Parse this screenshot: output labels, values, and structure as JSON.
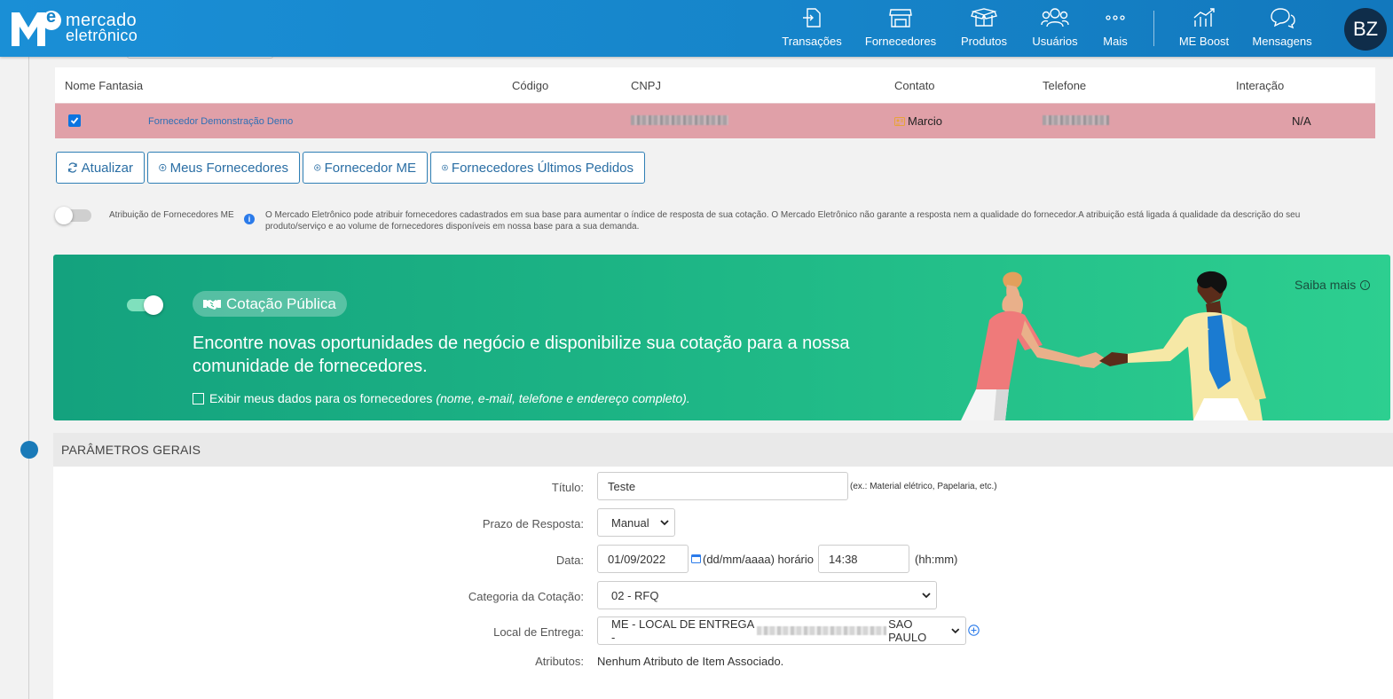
{
  "brand": {
    "line1": "mercado",
    "line2": "eletrônico",
    "mark_letter": "e"
  },
  "nav": [
    {
      "label": "Transações",
      "icon": "transactions-icon"
    },
    {
      "label": "Fornecedores",
      "icon": "store-icon"
    },
    {
      "label": "Produtos",
      "icon": "box-icon"
    },
    {
      "label": "Usuários",
      "icon": "users-icon"
    },
    {
      "label": "Mais",
      "icon": "more-icon"
    },
    {
      "label": "ME Boost",
      "icon": "chart-icon"
    },
    {
      "label": "Mensagens",
      "icon": "chat-icon"
    }
  ],
  "user": {
    "initials": "BZ"
  },
  "table": {
    "columns": [
      "Nome Fantasia",
      "Código",
      "CNPJ",
      "Contato",
      "Telefone",
      "Interação"
    ],
    "row": {
      "name": "Fornecedor Demonstração Demo",
      "contact": "Marcio",
      "interaction": "N/A",
      "checked": true
    }
  },
  "buttons": {
    "refresh": "Atualizar",
    "my_suppliers": "Meus Fornecedores",
    "me_supplier": "Fornecedor ME",
    "last_orders": "Fornecedores Últimos Pedidos"
  },
  "attribution": {
    "label": "Atribuição de Fornecedores ME",
    "description": "O Mercado Eletrônico pode atribuir fornecedores cadastrados em sua base para aumentar o índice de resposta de sua cotação. O Mercado Eletrônico não garante a resposta nem a qualidade do fornecedor.A atribuição está ligada á qualidade da descrição do seu produto/serviço e ao volume de fornecedores disponíveis em nossa base para a sua demanda.",
    "enabled": false
  },
  "banner": {
    "badge": "Cotação Pública",
    "headline": "Encontre novas oportunidades de negócio e disponibilize sua cotação para a nossa comunidade de fornecedores.",
    "checkbox_text": "Exibir meus dados para os fornecedores",
    "checkbox_italic": "(nome, e-mail, telefone e endereço completo).",
    "learn_more": "Saiba mais",
    "enabled": true,
    "colors": {
      "start": "#14a27e",
      "end": "#2dcf90"
    }
  },
  "params": {
    "section_title": "PARÂMETROS GERAIS",
    "title_label": "Título:",
    "title_value": "Teste",
    "title_hint": "(ex.: Material elétrico, Papelaria, etc.)",
    "deadline_label": "Prazo de Resposta:",
    "deadline_value": "Manual",
    "date_label": "Data:",
    "date_value": "01/09/2022",
    "date_hint": "(dd/mm/aaaa) horário",
    "time_value": "14:38",
    "time_hint": "(hh:mm)",
    "category_label": "Categoria da Cotação:",
    "category_value": "02 - RFQ",
    "delivery_label": "Local de Entrega:",
    "delivery_prefix": "ME - LOCAL DE ENTREGA -",
    "delivery_suffix": "SAO PAULO",
    "attributes_label": "Atributos:",
    "attributes_value": "Nenhum Atributo de Item Associado."
  },
  "colors": {
    "header": "#1684c9",
    "selected_row": "#e0a0a8",
    "accent": "#2a6ea4"
  }
}
